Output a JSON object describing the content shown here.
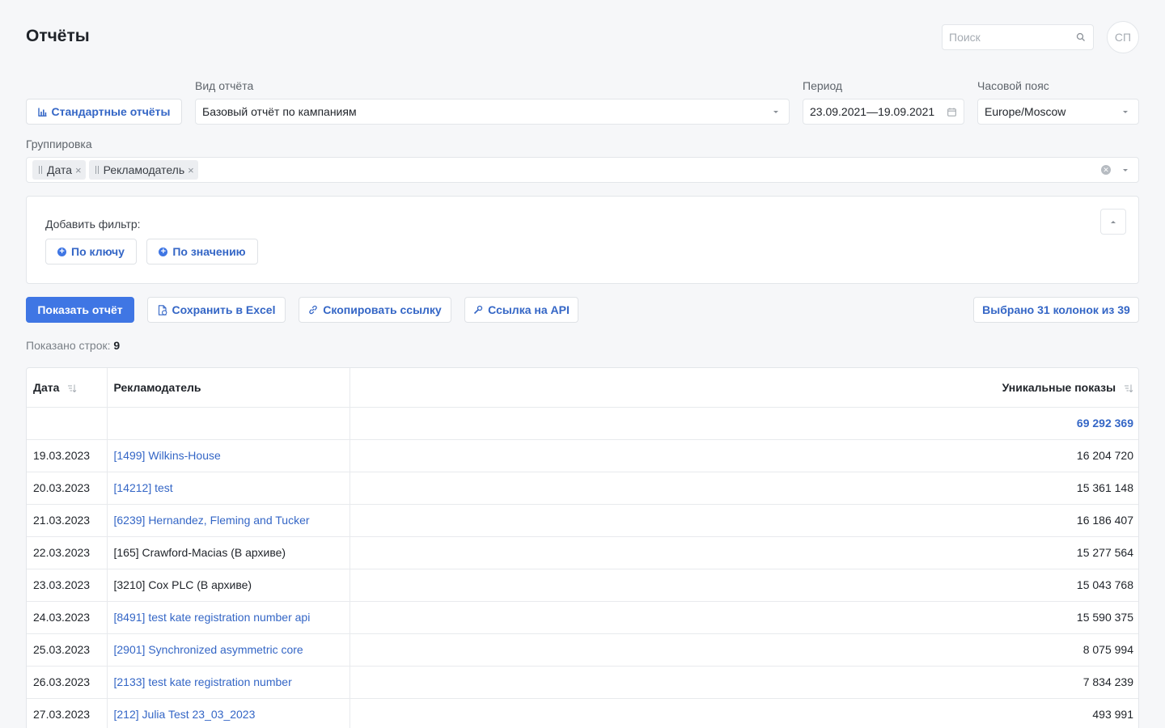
{
  "header": {
    "title": "Отчёты",
    "search_placeholder": "Поиск",
    "avatar_initials": "СП"
  },
  "controls": {
    "standard_reports_label": "Стандартные отчёты",
    "report_type_label": "Вид отчёта",
    "report_type_value": "Базовый отчёт по кампаниям",
    "period_label": "Период",
    "period_value": "23.09.2021—19.09.2021",
    "timezone_label": "Часовой пояс",
    "timezone_value": "Europe/Moscow",
    "grouping_label": "Группировка",
    "grouping_tags": [
      "Дата",
      "Рекламодатель"
    ]
  },
  "filters": {
    "add_filter_label": "Добавить фильтр:",
    "by_key_label": "По ключу",
    "by_value_label": "По значению"
  },
  "actions": {
    "show_report": "Показать отчёт",
    "save_excel": "Сохранить в Excel",
    "copy_link": "Скопировать ссылку",
    "api_link": "Ссылка на API",
    "columns_selected": "Выбрано 31 колонок из 39"
  },
  "rows_info": {
    "label": "Показано строк:",
    "count": "9"
  },
  "table": {
    "columns": [
      "Дата",
      "Рекламодатель",
      "Уникальные показы"
    ],
    "total": "69 292 369",
    "rows": [
      {
        "date": "19.03.2023",
        "advertiser": "[1499] Wilkins-House",
        "link": true,
        "value": "16 204 720"
      },
      {
        "date": "20.03.2023",
        "advertiser": "[14212] test",
        "link": true,
        "value": "15 361 148"
      },
      {
        "date": "21.03.2023",
        "advertiser": "[6239] Hernandez, Fleming and Tucker",
        "link": true,
        "value": "16 186 407"
      },
      {
        "date": "22.03.2023",
        "advertiser": "[165] Crawford-Macias (В архиве)",
        "link": false,
        "value": "15 277 564"
      },
      {
        "date": "23.03.2023",
        "advertiser": "[3210] Cox PLC (В архиве)",
        "link": false,
        "value": "15 043 768"
      },
      {
        "date": "24.03.2023",
        "advertiser": "[8491] test kate registration number api",
        "link": true,
        "value": "15 590 375"
      },
      {
        "date": "25.03.2023",
        "advertiser": "[2901] Synchronized asymmetric core",
        "link": true,
        "value": "8 075 994"
      },
      {
        "date": "26.03.2023",
        "advertiser": "[2133] test kate registration number",
        "link": true,
        "value": "7 834 239"
      },
      {
        "date": "27.03.2023",
        "advertiser": "[212] Julia Test 23_03_2023",
        "link": true,
        "value": "493 991"
      }
    ]
  },
  "colors": {
    "accent": "#3f76e4",
    "link": "#3466c6",
    "background": "#f6f7f9",
    "border": "#e3e6ea"
  }
}
